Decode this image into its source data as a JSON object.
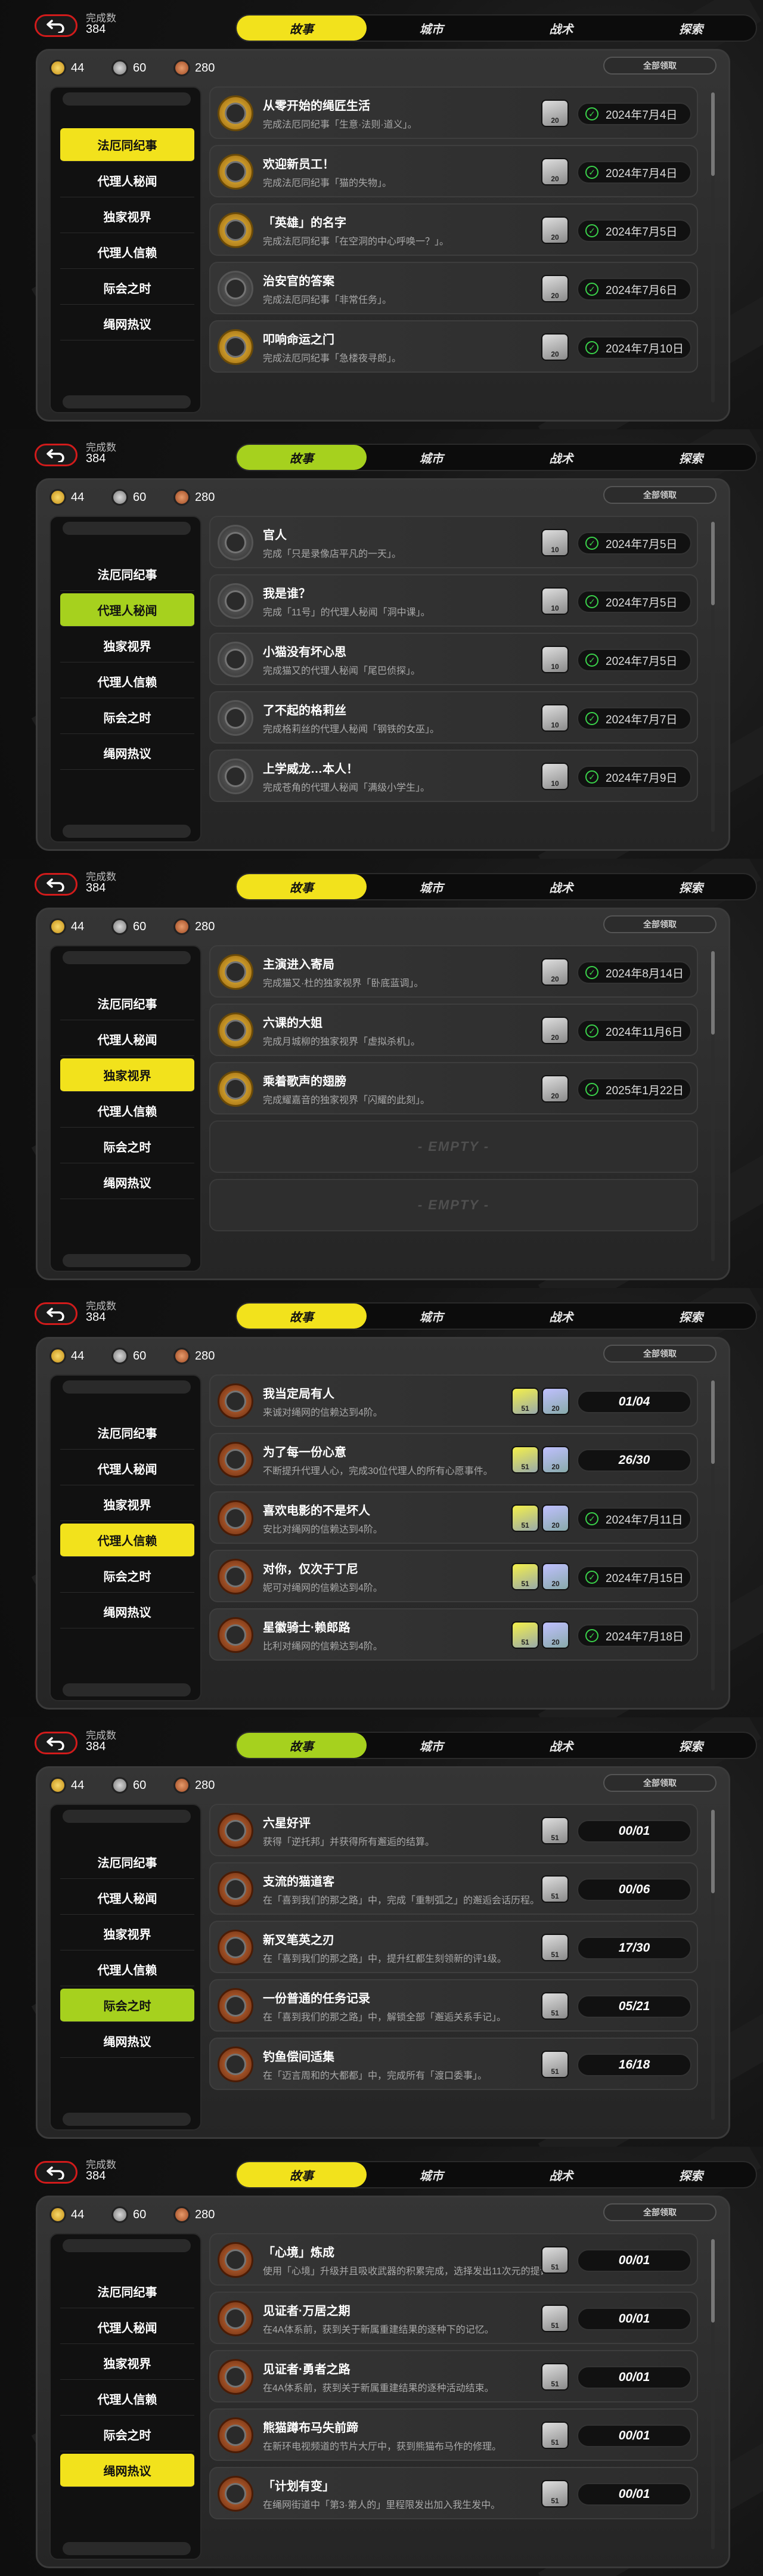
{
  "header": {
    "completed_label": "完成数",
    "completed_value": "384",
    "back_icon": "back-arrow-icon"
  },
  "tabs": [
    "故事",
    "城市",
    "战术",
    "探索"
  ],
  "currency": {
    "gold": "44",
    "silver": "60",
    "bronze": "280"
  },
  "claim_all": "全部领取",
  "categories": [
    "法厄同纪事",
    "代理人秘闻",
    "独家视界",
    "代理人信赖",
    "际会之时",
    "绳网热议"
  ],
  "accent": {
    "yellow": "#f2e21c",
    "green": "#a6d11e",
    "red": "#d11b1b"
  },
  "empty_label": "- EMPTY -",
  "panels": [
    {
      "active_tab": 0,
      "active_cat": 0,
      "accent": "yellow",
      "items": [
        {
          "title": "从零开始的绳匠生活",
          "desc": "完成法厄同纪事「生意·法则·道义」。",
          "rw": [
            "20"
          ],
          "date": "2024年7月4日",
          "icon": "gold"
        },
        {
          "title": "欢迎新员工！",
          "desc": "完成法厄同纪事「猫的失物」。",
          "rw": [
            "20"
          ],
          "date": "2024年7月4日",
          "icon": "gold"
        },
        {
          "title": "「英雄」的名字",
          "desc": "完成法厄同纪事「在空洞的中心呼唤一？」。",
          "rw": [
            "20"
          ],
          "date": "2024年7月5日",
          "icon": "gold"
        },
        {
          "title": "治安官的答案",
          "desc": "完成法厄同纪事「非常任务」。",
          "rw": [
            "20"
          ],
          "date": "2024年7月6日",
          "icon": "silver"
        },
        {
          "title": "叩响命运之门",
          "desc": "完成法厄同纪事「急楼夜寻郎」。",
          "rw": [
            "20"
          ],
          "date": "2024年7月10日",
          "icon": "gold"
        }
      ]
    },
    {
      "active_tab": 0,
      "active_cat": 1,
      "accent": "green",
      "items": [
        {
          "title": "官人",
          "desc": "完成「只是录像店平凡的一天」。",
          "rw": [
            "10"
          ],
          "date": "2024年7月5日",
          "icon": "silver"
        },
        {
          "title": "我是谁？",
          "desc": "完成「11号」的代理人秘闻「洞中课」。",
          "rw": [
            "10"
          ],
          "date": "2024年7月5日",
          "icon": "silver"
        },
        {
          "title": "小猫没有坏心思",
          "desc": "完成猫又的代理人秘闻「尾巴侦探」。",
          "rw": [
            "10"
          ],
          "date": "2024年7月5日",
          "icon": "silver"
        },
        {
          "title": "了不起的格莉丝",
          "desc": "完成格莉丝的代理人秘闻「钢铁的女巫」。",
          "rw": [
            "10"
          ],
          "date": "2024年7月7日",
          "icon": "silver"
        },
        {
          "title": "上学威龙…本人！",
          "desc": "完成苍角的代理人秘闻「满级小学生」。",
          "rw": [
            "10"
          ],
          "date": "2024年7月9日",
          "icon": "silver"
        }
      ]
    },
    {
      "active_tab": 0,
      "active_cat": 2,
      "accent": "yellow",
      "items": [
        {
          "title": "主演进入寄局",
          "desc": "完成猫又·杜的独家视界「卧底蓝调」。",
          "rw": [
            "20"
          ],
          "date": "2024年8月14日",
          "icon": "gold"
        },
        {
          "title": "六课的大姐",
          "desc": "完成月城柳的独家视界「虚拟杀机」。",
          "rw": [
            "20"
          ],
          "date": "2024年11月6日",
          "icon": "gold"
        },
        {
          "title": "乘着歌声的翅膀",
          "desc": "完成耀嘉音的独家视界「闪耀的此刻」。",
          "rw": [
            "20"
          ],
          "date": "2025年1月22日",
          "icon": "gold"
        },
        {
          "empty": true
        },
        {
          "empty": true
        }
      ]
    },
    {
      "active_tab": 0,
      "active_cat": 3,
      "accent": "yellow",
      "items": [
        {
          "title": "我当定局有人",
          "desc": "来诚对绳网的信赖达到4阶。",
          "rw": [
            "51",
            "20"
          ],
          "progress": "01/04",
          "icon": "copper"
        },
        {
          "title": "为了每一份心意",
          "desc": "不断提升代理人心，完成30位代理人的所有心愿事件。",
          "rw": [
            "51",
            "20"
          ],
          "progress": "26/30",
          "icon": "copper"
        },
        {
          "title": "喜欢电影的不是坏人",
          "desc": "安比对绳网的信赖达到4阶。",
          "rw": [
            "51",
            "20"
          ],
          "date": "2024年7月11日",
          "icon": "copper"
        },
        {
          "title": "对你，仅次于丁尼",
          "desc": "妮可对绳网的信赖达到4阶。",
          "rw": [
            "51",
            "20"
          ],
          "date": "2024年7月15日",
          "icon": "copper"
        },
        {
          "title": "星徽骑士·赖郎路",
          "desc": "比利对绳网的信赖达到4阶。",
          "rw": [
            "51",
            "20"
          ],
          "date": "2024年7月18日",
          "icon": "copper"
        }
      ]
    },
    {
      "active_tab": 0,
      "active_cat": 4,
      "accent": "green",
      "items": [
        {
          "title": "六星好评",
          "desc": "获得「逆托邦」并获得所有邂逅的结算。",
          "rw": [
            "51"
          ],
          "progress": "00/01",
          "icon": "copper"
        },
        {
          "title": "支流的猫道客",
          "desc": "在「喜到我们的那之路」中，完成「重制弧之」的邂逅会话历程。",
          "rw": [
            "51"
          ],
          "progress": "00/06",
          "icon": "copper"
        },
        {
          "title": "新叉笔英之刃",
          "desc": "在「喜到我们的那之路」中，提升红都生刻领新的评1级。",
          "rw": [
            "51"
          ],
          "progress": "17/30",
          "icon": "copper"
        },
        {
          "title": "一份普通的任务记录",
          "desc": "在「喜到我们的那之路」中，解锁全部「邂逅关系手记」。",
          "rw": [
            "51"
          ],
          "progress": "05/21",
          "icon": "copper"
        },
        {
          "title": "钓鱼偿间适集",
          "desc": "在「迈言周和的大都都」中，完成所有「渡口委事」。",
          "rw": [
            "51"
          ],
          "progress": "16/18",
          "icon": "copper"
        }
      ]
    },
    {
      "active_tab": 0,
      "active_cat": 5,
      "accent": "yellow",
      "items": [
        {
          "title": "「心境」炼成",
          "desc": "使用「心境」升级并且吸收武器的积累完成，选择发出11次元的提议。",
          "rw": [
            "51"
          ],
          "progress": "00/01",
          "icon": "copper"
        },
        {
          "title": "见证者·万居之期",
          "desc": "在4A体系前，获到关于新属重建结果的逐种下的记忆。",
          "rw": [
            "51"
          ],
          "progress": "00/01",
          "icon": "copper"
        },
        {
          "title": "见证者·勇者之路",
          "desc": "在4A体系前，获到关于新属重建结果的逐种活动结束。",
          "rw": [
            "51"
          ],
          "progress": "00/01",
          "icon": "copper"
        },
        {
          "title": "熊猫蹲布马失前蹄",
          "desc": "在新环电视频道的节片大厅中，获到熊猫布马作的修理。",
          "rw": [
            "51"
          ],
          "progress": "00/01",
          "icon": "copper"
        },
        {
          "title": "「计划有变」",
          "desc": "在绳网街道中「第3·第人的」里程限发出加入我生发中。",
          "rw": [
            "51"
          ],
          "progress": "00/01",
          "icon": "copper"
        }
      ]
    }
  ]
}
